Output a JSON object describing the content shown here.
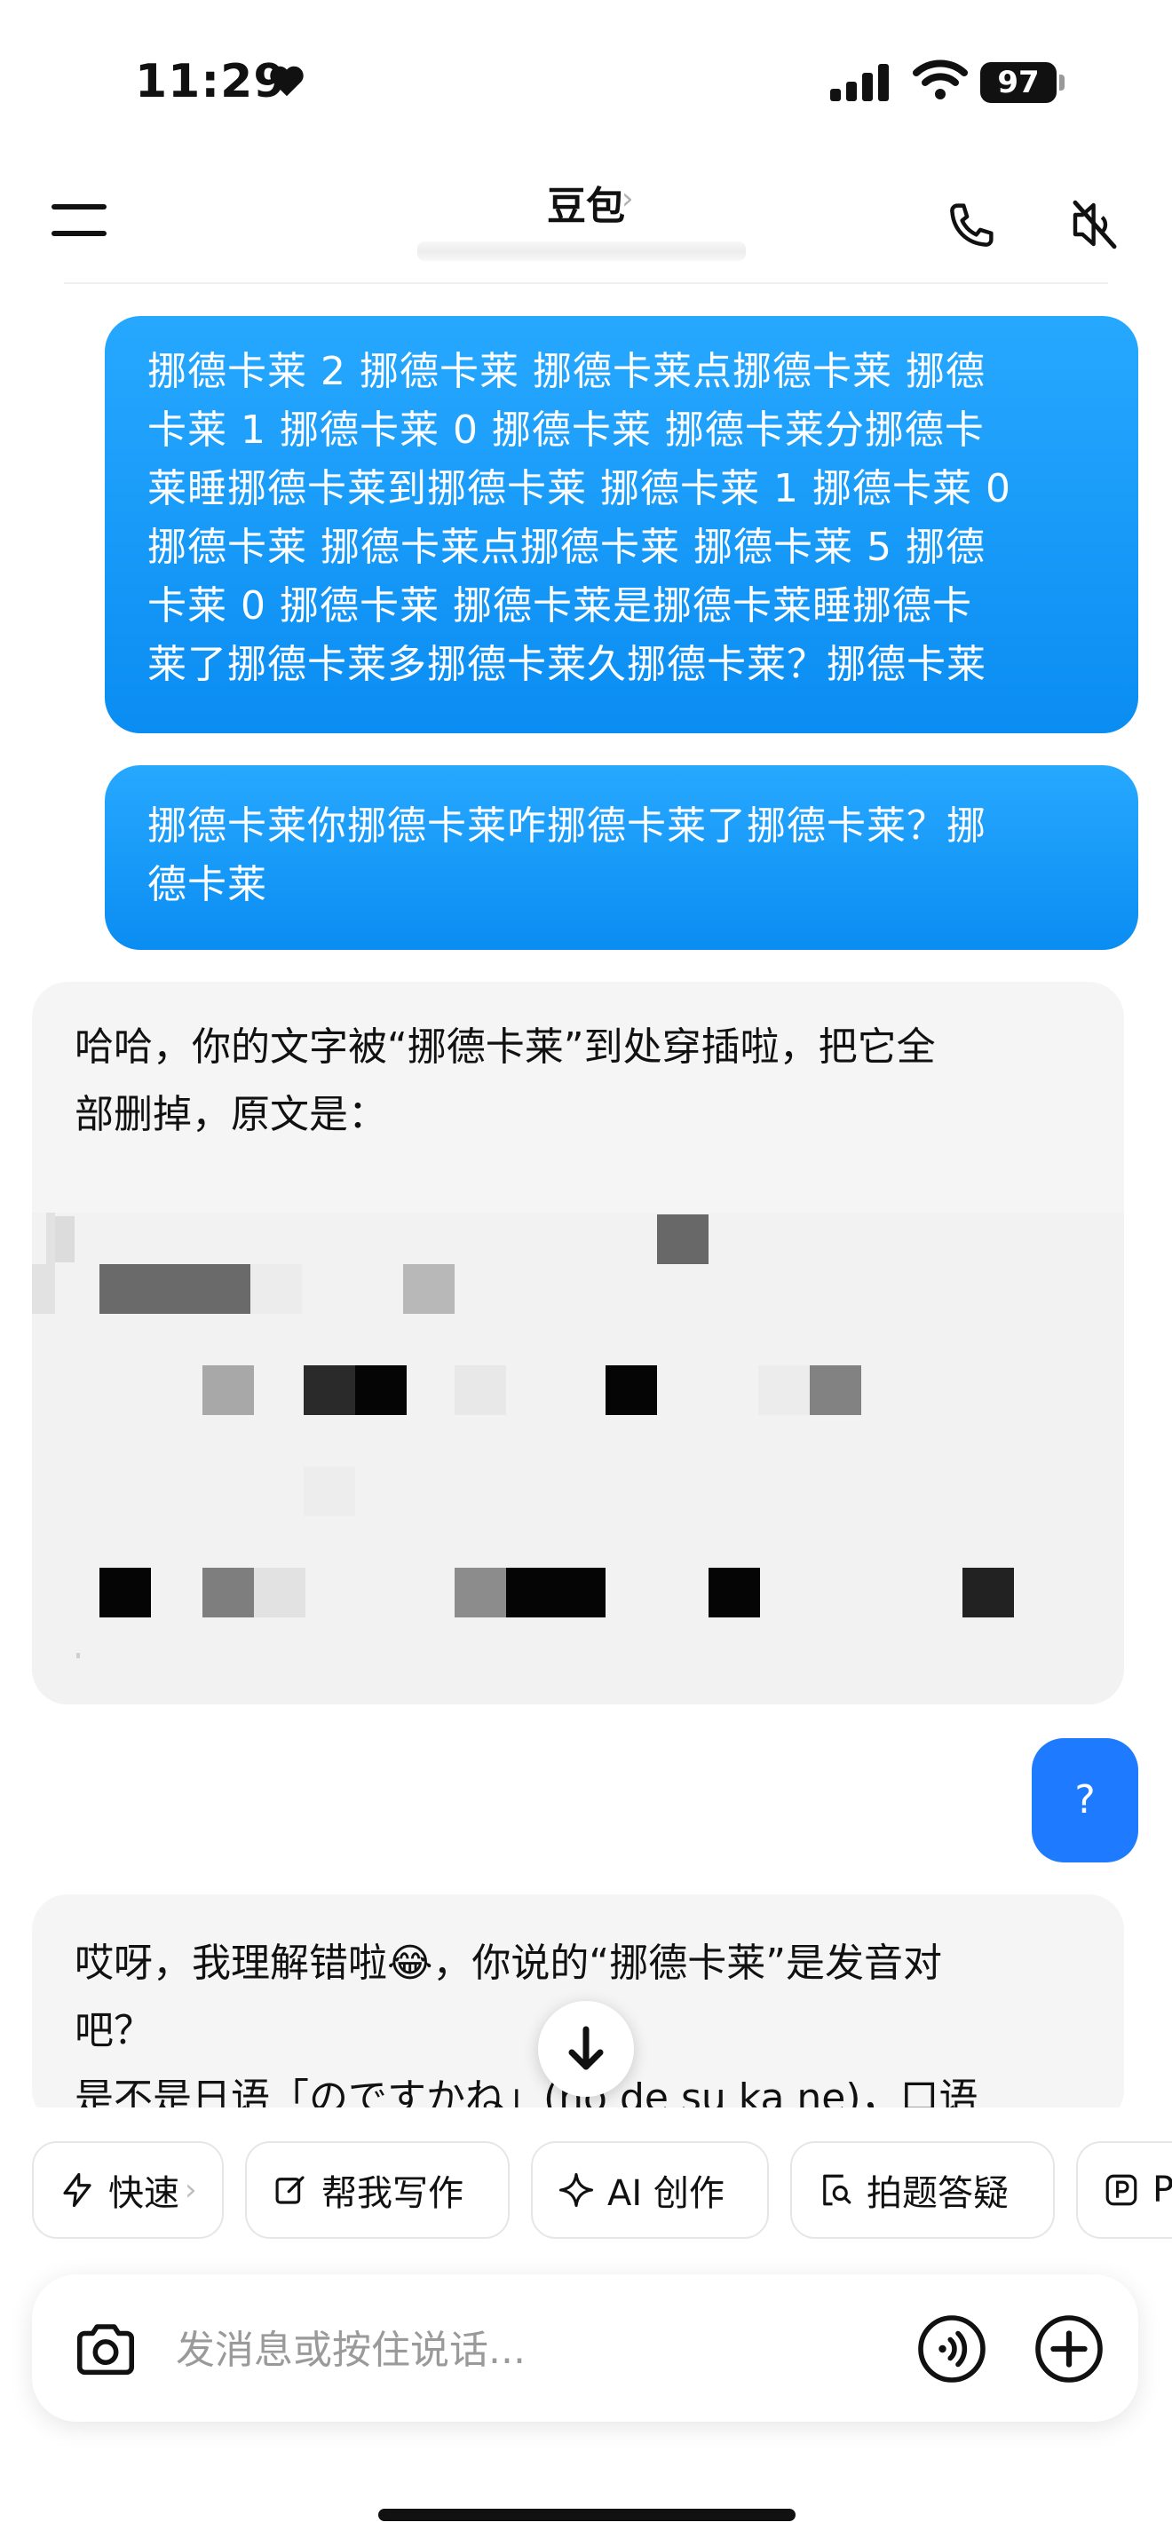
{
  "status_bar": {
    "time": "11:29",
    "battery": "97"
  },
  "header": {
    "title": "豆包",
    "chevron": "›"
  },
  "messages": {
    "user1": "挪德卡莱 2 挪德卡莱 挪德卡莱点挪德卡莱 挪德\n卡莱 1 挪德卡莱 0 挪德卡莱 挪德卡莱分挪德卡\n莱睡挪德卡莱到挪德卡莱 挪德卡莱 1 挪德卡莱 0\n挪德卡莱 挪德卡莱点挪德卡莱 挪德卡莱 5 挪德\n卡莱 0 挪德卡莱 挪德卡莱是挪德卡莱睡挪德卡\n莱了挪德卡莱多挪德卡莱久挪德卡莱？挪德卡莱",
    "user2": "挪德卡莱你挪德卡莱咋挪德卡莱了挪德卡莱？挪\n德卡莱",
    "bot1": "哈哈，你的文字被“挪德卡莱”到处穿插啦，把它全\n部删掉，原文是：",
    "user3": "?",
    "bot2": "哎呀，我理解错啦😂，你说的“挪德卡莱”是发音对\n吧？\n是不是日语「のですかね」(no de su ka ne)，口语"
  },
  "chips": [
    {
      "label": "快速",
      "icon": "lightning-icon",
      "has_arrow": true,
      "arrow": "›"
    },
    {
      "label": "帮我写作",
      "icon": "edit-icon"
    },
    {
      "label": "AI 创作",
      "icon": "sparkle-icon"
    },
    {
      "label": "拍题答疑",
      "icon": "photo-question-icon"
    },
    {
      "label": "P",
      "icon": "p-icon"
    }
  ],
  "input": {
    "placeholder": "发消息或按住说话..."
  },
  "colors": {
    "user_bubble": "#1a9bf7",
    "question_bubble": "#1e7bff",
    "bot_bubble": "#f5f5f5"
  }
}
